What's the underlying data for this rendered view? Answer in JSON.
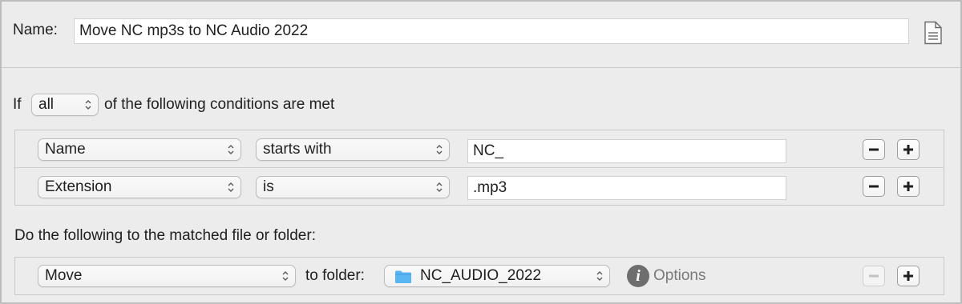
{
  "rule": {
    "name_label": "Name:",
    "name_value": "Move NC mp3s to NC Audio 2022",
    "doc_icon": "document-icon"
  },
  "conditions": {
    "prefix": "If",
    "match_mode": "all",
    "suffix": "of the following conditions are met",
    "rows": [
      {
        "attribute": "Name",
        "operator": "starts with",
        "value": "NC_"
      },
      {
        "attribute": "Extension",
        "operator": "is",
        "value": ".mp3"
      }
    ]
  },
  "actions": {
    "heading": "Do the following to the matched file or folder:",
    "rows": [
      {
        "action": "Move",
        "target_label": "to folder:",
        "folder": "NC_AUDIO_2022",
        "folder_icon": "folder-icon",
        "info_icon": "info-icon",
        "options_label": "Options",
        "remove_enabled": false
      }
    ]
  },
  "colors": {
    "folder_blue": "#59b6f2",
    "disabled_gray": "#c2c2c2"
  }
}
